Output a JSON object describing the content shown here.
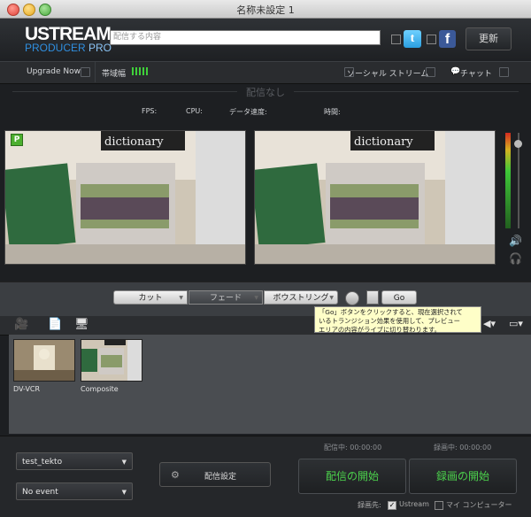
{
  "window": {
    "title": "名称未設定 1"
  },
  "header": {
    "logo_line1": "USTREAM",
    "logo_line2a": "PRODUCER",
    "logo_line2b": "PRO",
    "status_placeholder": "配信する内容",
    "update_label": "更新",
    "twitter_icon": "twitter-icon",
    "facebook_icon": "facebook-icon"
  },
  "nav": {
    "upgrade": "Upgrade Now",
    "bandwidth": "帯域幅",
    "social": "ソーシャル ストリーム",
    "chat": "チャット"
  },
  "stream": {
    "status": "配信なし",
    "fps_label": "FPS:",
    "cpu_label": "CPU:",
    "datarate_label": "データ速度:",
    "time_label": "時間:"
  },
  "preview": {
    "badge": "P"
  },
  "transitions": {
    "cut": "カット",
    "fade": "フェード",
    "pip": "ボウストリング",
    "go": "Go"
  },
  "tooltip": {
    "line1": "「Go」ボタンをクリックすると、現在選択されて",
    "line2": "いるトランジション効果を使用して、プレビュー",
    "line3": "エリアの内容がライブに切り替わります。"
  },
  "sources": [
    {
      "label": "DV-VCR"
    },
    {
      "label": "Composite"
    }
  ],
  "bottom": {
    "account": "test_tekto",
    "event": "No event",
    "settings": "配信設定",
    "stream_time": "配信中: 00:00:00",
    "record_time": "録画中: 00:00:00",
    "start_stream": "配信の開始",
    "start_record": "録画の開始",
    "record_dest": "録画先:",
    "dest_ustream": "Ustream",
    "dest_computer": "マイ コンピューター"
  },
  "colors": {
    "accent_green": "#4cd34c",
    "brand_blue": "#2f8fe0"
  }
}
